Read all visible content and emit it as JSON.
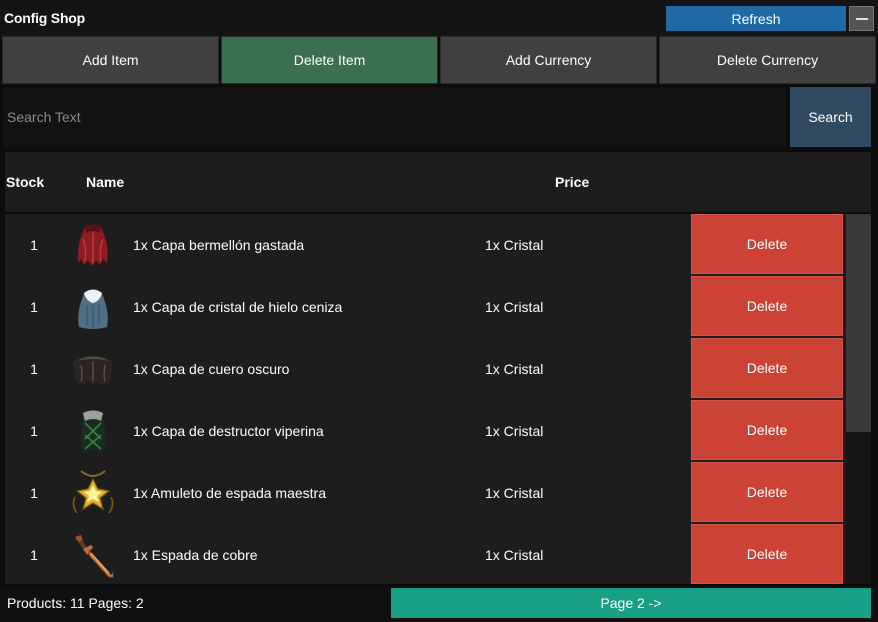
{
  "window": {
    "title": "Config Shop"
  },
  "toolbar": {
    "refresh_label": "Refresh"
  },
  "tabs": [
    {
      "label": "Add Item",
      "active": false
    },
    {
      "label": "Delete Item",
      "active": true
    },
    {
      "label": "Add Currency",
      "active": false
    },
    {
      "label": "Delete Currency",
      "active": false
    }
  ],
  "search": {
    "placeholder": "Search Text",
    "value": "",
    "button_label": "Search"
  },
  "table": {
    "headers": {
      "stock": "Stock",
      "name": "Name",
      "price": "Price"
    },
    "rows": [
      {
        "stock": "1",
        "name": "1x Capa bermellón gastada",
        "price": "1x Cristal",
        "action": "Delete",
        "icon": "red-cape-icon"
      },
      {
        "stock": "1",
        "name": "1x Capa de cristal de hielo ceniza",
        "price": "1x Cristal",
        "action": "Delete",
        "icon": "ice-cape-icon"
      },
      {
        "stock": "1",
        "name": "1x Capa de cuero oscuro",
        "price": "1x Cristal",
        "action": "Delete",
        "icon": "leather-cape-icon"
      },
      {
        "stock": "1",
        "name": "1x Capa de destructor viperina",
        "price": "1x Cristal",
        "action": "Delete",
        "icon": "viper-cape-icon"
      },
      {
        "stock": "1",
        "name": "1x Amuleto de espada maestra",
        "price": "1x Cristal",
        "action": "Delete",
        "icon": "amulet-icon"
      },
      {
        "stock": "1",
        "name": "1x Espada de cobre",
        "price": "1x Cristal",
        "action": "Delete",
        "icon": "copper-sword-icon"
      }
    ]
  },
  "footer": {
    "info": "Products: 11 Pages: 2",
    "page_button": "Page 2 ->"
  },
  "colors": {
    "refresh": "#1f6aa5",
    "active_tab": "#3a6f4f",
    "delete": "#cc4235",
    "search_button": "#304a63",
    "page_button": "#18a086"
  }
}
